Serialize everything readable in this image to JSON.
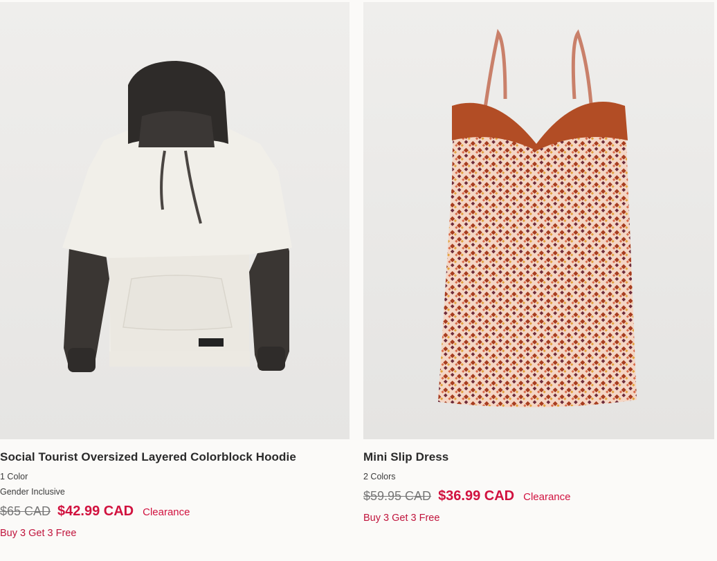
{
  "products": [
    {
      "name": "Social Tourist Oversized Layered Colorblock Hoodie",
      "colors": "1 Color",
      "attribute": "Gender Inclusive",
      "original_price": "$65 CAD",
      "sale_price": "$42.99 CAD",
      "status": "Clearance",
      "promo": "Buy 3 Get 3 Free",
      "image": "hoodie-product-image"
    },
    {
      "name": "Mini Slip Dress",
      "colors": "2 Colors",
      "original_price": "$59.95 CAD",
      "sale_price": "$36.99 CAD",
      "status": "Clearance",
      "promo": "Buy 3 Get 3 Free",
      "image": "slip-dress-product-image"
    }
  ],
  "colors": {
    "sale": "#d1123f",
    "original": "#777777",
    "title": "#2a2a2a",
    "image_bg": "#eceae8"
  }
}
